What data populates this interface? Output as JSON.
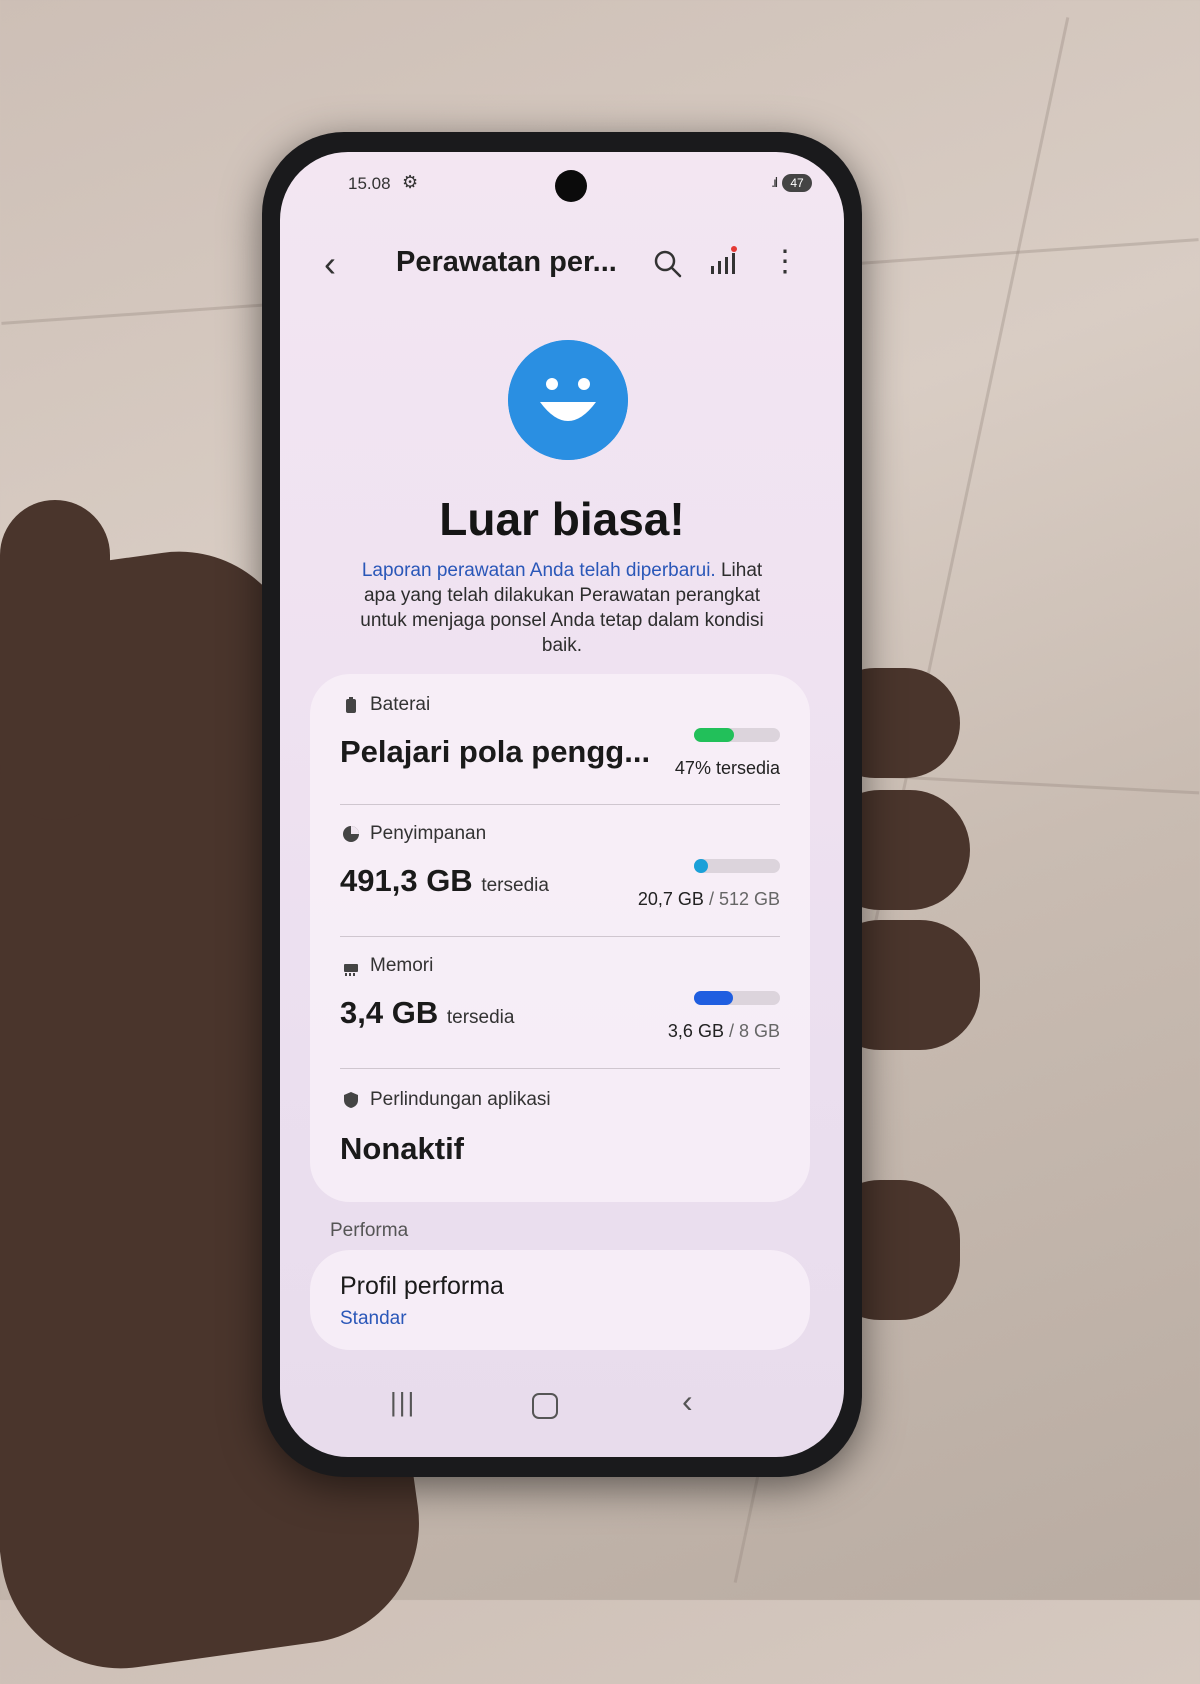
{
  "status_bar": {
    "time": "15.08",
    "battery": "47"
  },
  "app_bar": {
    "title": "Perawatan per...",
    "back_icon": "chevron-left-icon",
    "search_icon": "search-icon",
    "stats_icon": "bar-chart-icon",
    "more_icon": "more-vertical-icon"
  },
  "hero": {
    "icon": "smiley-icon",
    "headline": "Luar biasa!",
    "description_link": "Laporan perawatan Anda telah diperbarui.",
    "description_rest": " Lihat apa yang telah dilakukan Perawatan perangkat untuk menjaga ponsel Anda tetap dalam kondisi baik."
  },
  "sections": {
    "battery": {
      "label": "Baterai",
      "value": "Pelajari pola pengg...",
      "caption": "47% tersedia",
      "level": 0.47,
      "color": "#22c05a"
    },
    "storage": {
      "label": "Penyimpanan",
      "value": "491,3 GB",
      "value_suffix": "tersedia",
      "used": "20,7 GB",
      "total": "/ 512 GB",
      "level": 0.04,
      "color": "#1aa0d8"
    },
    "memory": {
      "label": "Memori",
      "value": "3,4 GB",
      "value_suffix": "tersedia",
      "used": "3,6 GB",
      "total": "/ 8 GB",
      "level": 0.45,
      "color": "#1f5ee0"
    },
    "app_protection": {
      "label": "Perlindungan aplikasi",
      "value": "Nonaktif"
    }
  },
  "performance": {
    "header": "Performa",
    "title": "Profil performa",
    "value": "Standar"
  },
  "nav_bar": {
    "recent_icon": "recent-apps-icon",
    "home_icon": "home-icon",
    "back_icon": "back-icon"
  }
}
